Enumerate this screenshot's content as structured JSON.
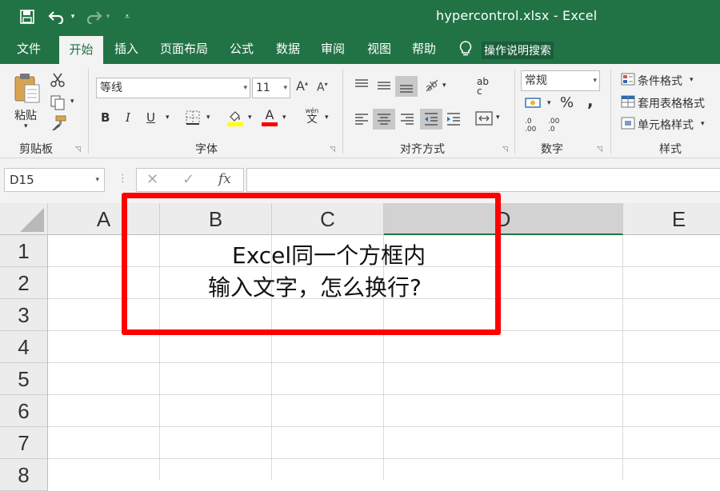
{
  "window": {
    "title": "hypercontrol.xlsx  -  Excel"
  },
  "tabs": [
    {
      "label": "文件"
    },
    {
      "label": "开始"
    },
    {
      "label": "插入"
    },
    {
      "label": "页面布局"
    },
    {
      "label": "公式"
    },
    {
      "label": "数据"
    },
    {
      "label": "审阅"
    },
    {
      "label": "视图"
    },
    {
      "label": "帮助"
    }
  ],
  "tell_me": {
    "label": "操作说明搜索"
  },
  "ribbon": {
    "clipboard": {
      "paste_label": "粘贴",
      "group_label": "剪贴板"
    },
    "font": {
      "font_name": "等线",
      "font_size": "11",
      "bold": "B",
      "italic": "I",
      "underline": "U",
      "font_color_letter": "A",
      "phonetic_top": "wén",
      "phonetic_bottom": "文",
      "group_label": "字体"
    },
    "alignment": {
      "group_label": "对齐方式",
      "wrap_top": "ab",
      "wrap_bottom": "c"
    },
    "number": {
      "format": "常规",
      "percent": "%",
      "comma": ",",
      "inc_decimal": ".0 .00",
      "dec_decimal": ".00 .0",
      "group_label": "数字"
    },
    "styles": {
      "conditional": "条件格式",
      "table": "套用表格格式",
      "cell": "单元格样式",
      "group_label": "样式"
    }
  },
  "formula_bar": {
    "name_box": "D15",
    "cancel": "✕",
    "enter": "✓",
    "fx": "fx",
    "value": ""
  },
  "grid": {
    "columns": [
      "A",
      "B",
      "C",
      "D",
      "E"
    ],
    "rows": [
      "1",
      "2",
      "3",
      "4",
      "5",
      "6",
      "7",
      "8"
    ]
  },
  "overlay": {
    "line1": "Excel同一个方框内",
    "line2": "输入文字，怎么换行?"
  },
  "colors": {
    "brand": "#217346",
    "highlight_red": "#ff0000",
    "fill_yellow": "#ffff00",
    "font_red": "#ff0000"
  }
}
